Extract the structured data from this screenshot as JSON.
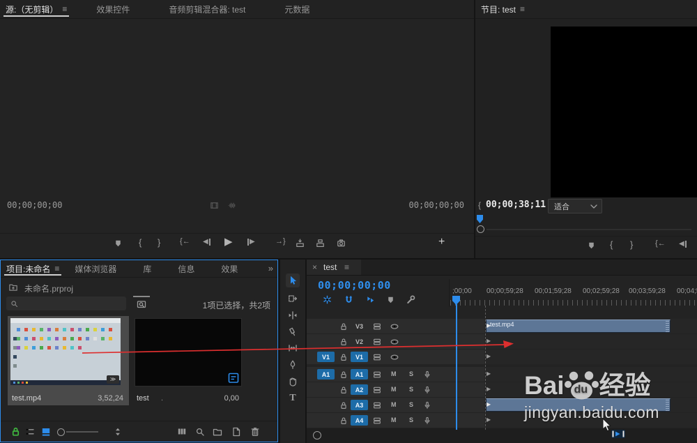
{
  "source_monitor": {
    "tabs": [
      {
        "label": "源:（无剪辑）",
        "active": true
      },
      {
        "label": "效果控件",
        "active": false
      },
      {
        "label": "音频剪辑混合器: test",
        "active": false
      },
      {
        "label": "元数据",
        "active": false
      }
    ],
    "timecode_left": "00;00;00;00",
    "timecode_right": "00;00;00;00"
  },
  "program_monitor": {
    "tab_label": "节目: test",
    "timecode": "00;00;38;11",
    "fit_dropdown": "适合"
  },
  "project_panel": {
    "tabs": [
      {
        "label": "项目:未命名",
        "active": true
      },
      {
        "label": "媒体浏览器",
        "active": false
      },
      {
        "label": "库",
        "active": false
      },
      {
        "label": "信息",
        "active": false
      },
      {
        "label": "效果",
        "active": false
      }
    ],
    "breadcrumb": "未命名.prproj",
    "search_placeholder": "",
    "selection_status": "1项已选择，共2项",
    "items": [
      {
        "name": "test.mp4",
        "duration": "3,52,24",
        "selected": true
      },
      {
        "name": "test",
        "name_suffix": ".",
        "duration": "0,00",
        "selected": false
      }
    ]
  },
  "timeline": {
    "tab_label": "test",
    "timecode": "00;00;00;00",
    "ruler_labels": [
      ";00;00",
      "00;00;59;28",
      "00;01;59;28",
      "00;02;59;28",
      "00;03;59;28",
      "00;04;5"
    ],
    "clip_name": "test.mp4",
    "video_tracks": [
      {
        "id": "V3",
        "source": ""
      },
      {
        "id": "V2",
        "source": ""
      },
      {
        "id": "V1",
        "source": "V1"
      }
    ],
    "audio_tracks": [
      {
        "id": "A1",
        "source": "A1"
      },
      {
        "id": "A2",
        "source": ""
      },
      {
        "id": "A3",
        "source": ""
      },
      {
        "id": "A4",
        "source": ""
      }
    ],
    "mute_label": "M",
    "solo_label": "S"
  },
  "watermark": {
    "bai": "Bai",
    "du": "du",
    "brand_suffix": "经验",
    "url": "jingyan.baidu.com"
  },
  "icons": {
    "menu": "≡",
    "close": "×",
    "overflow": "»",
    "bracket_in": "{",
    "bracket_out": "}",
    "play": "▶",
    "step_back": "◀",
    "step_fwd": "▶",
    "arrow_left": "←",
    "arrow_right": "→",
    "plus": "+",
    "track_arrow": "▶",
    "film_badge": "≫",
    "type_tool": "T"
  },
  "colors": {
    "accent_blue": "#2d8ceb",
    "badge_blue": "#1d6ca8",
    "unlock_green": "#3fb53f",
    "clip_fill": "#5d7696",
    "red_arrow": "#dd2f2f",
    "selected_tile": "#4a4a4a"
  }
}
